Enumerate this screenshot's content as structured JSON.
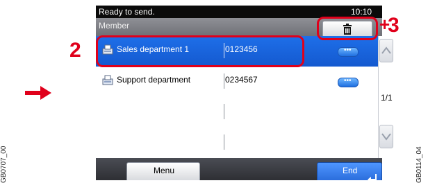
{
  "status": {
    "message": "Ready to send.",
    "time": "10:10"
  },
  "header": {
    "title": "Member"
  },
  "callouts": {
    "step2": "2",
    "step3": "3",
    "plus": "+"
  },
  "rows": [
    {
      "name": "Sales department 1",
      "number": "0123456",
      "selected": true
    },
    {
      "name": "Support department",
      "number": "0234567",
      "selected": false
    },
    {
      "name": "",
      "number": "",
      "selected": false
    },
    {
      "name": "",
      "number": "",
      "selected": false
    }
  ],
  "pager": {
    "page": "1/1"
  },
  "footer": {
    "menu_label": "Menu",
    "end_label": "End"
  },
  "codes": {
    "left": "GB0707_00",
    "right": "GB0114_04"
  },
  "colors": {
    "accent": "#e0001b",
    "selection": "#1e6fe9"
  },
  "icons": {
    "arrow": "arrow-right-icon",
    "trash": "trash-icon",
    "fax": "fax-icon",
    "more": "ellipsis-icon",
    "scroll_up": "chevron-up-icon",
    "scroll_down": "chevron-down-icon",
    "enter": "enter-icon"
  }
}
